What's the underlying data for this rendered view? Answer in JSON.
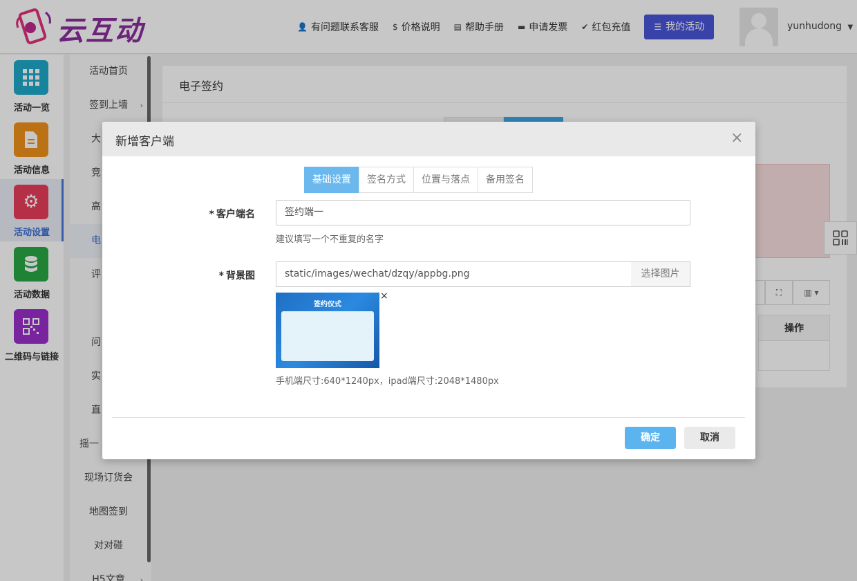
{
  "header": {
    "logo_text": "云互动",
    "nav": [
      {
        "label": "有问题联系客服",
        "icon": "user-plus-icon"
      },
      {
        "label": "价格说明",
        "icon": "dollar-icon"
      },
      {
        "label": "帮助手册",
        "icon": "book-icon"
      },
      {
        "label": "申请发票",
        "icon": "printer-icon"
      },
      {
        "label": "红包充值",
        "icon": "shield-check-icon"
      }
    ],
    "my_activity": "我的活动",
    "username": "yunhudong"
  },
  "sidebar": {
    "items": [
      {
        "label": "活动一览",
        "color": "#1fa8c9",
        "icon": "grid-icon"
      },
      {
        "label": "活动信息",
        "color": "#f0921a",
        "icon": "document-icon"
      },
      {
        "label": "活动设置",
        "color": "#e83d5c",
        "icon": "gear-icon"
      },
      {
        "label": "活动数据",
        "color": "#28a745",
        "icon": "database-icon"
      },
      {
        "label": "二维码与链接",
        "color": "#9b2fcc",
        "icon": "qrcode-icon"
      }
    ],
    "active_index": 2
  },
  "submenu": {
    "items": [
      {
        "label": "活动首页"
      },
      {
        "label": "签到上墙",
        "chevron": "›"
      },
      {
        "label": "大"
      },
      {
        "label": "竞"
      },
      {
        "label": "高"
      },
      {
        "label": "电"
      },
      {
        "label": "评"
      },
      {
        "label": ""
      },
      {
        "label": "问"
      },
      {
        "label": "实"
      },
      {
        "label": "直"
      },
      {
        "label": "摇一"
      },
      {
        "label": "现场订货会"
      },
      {
        "label": "地图签到"
      },
      {
        "label": "对对碰"
      },
      {
        "label": "H5文章",
        "chevron": "›"
      }
    ]
  },
  "panel": {
    "title": "电子签约",
    "table_op_header": "操作"
  },
  "modal": {
    "title": "新增客户端",
    "close": "×",
    "tabs": [
      "基础设置",
      "签名方式",
      "位置与落点",
      "备用签名"
    ],
    "active_tab": 0,
    "client_name": {
      "required": "*",
      "label": "客户端名",
      "value": "签约端一",
      "help": "建议填写一个不重复的名字"
    },
    "background": {
      "required": "*",
      "label": "背景图",
      "value": "static/images/wechat/dzqy/appbg.png",
      "choose_button": "选择图片",
      "thumb_title": "签约仪式",
      "delete": "×",
      "help": "手机端尺寸:640*1240px，ipad端尺寸:2048*1480px"
    },
    "ok": "确定",
    "cancel": "取消"
  },
  "colors": {
    "primary": "#4a55d9",
    "tab_active": "#6ab8ee",
    "ok_button": "#5cb4ee",
    "logo": "#8b2f9e"
  }
}
